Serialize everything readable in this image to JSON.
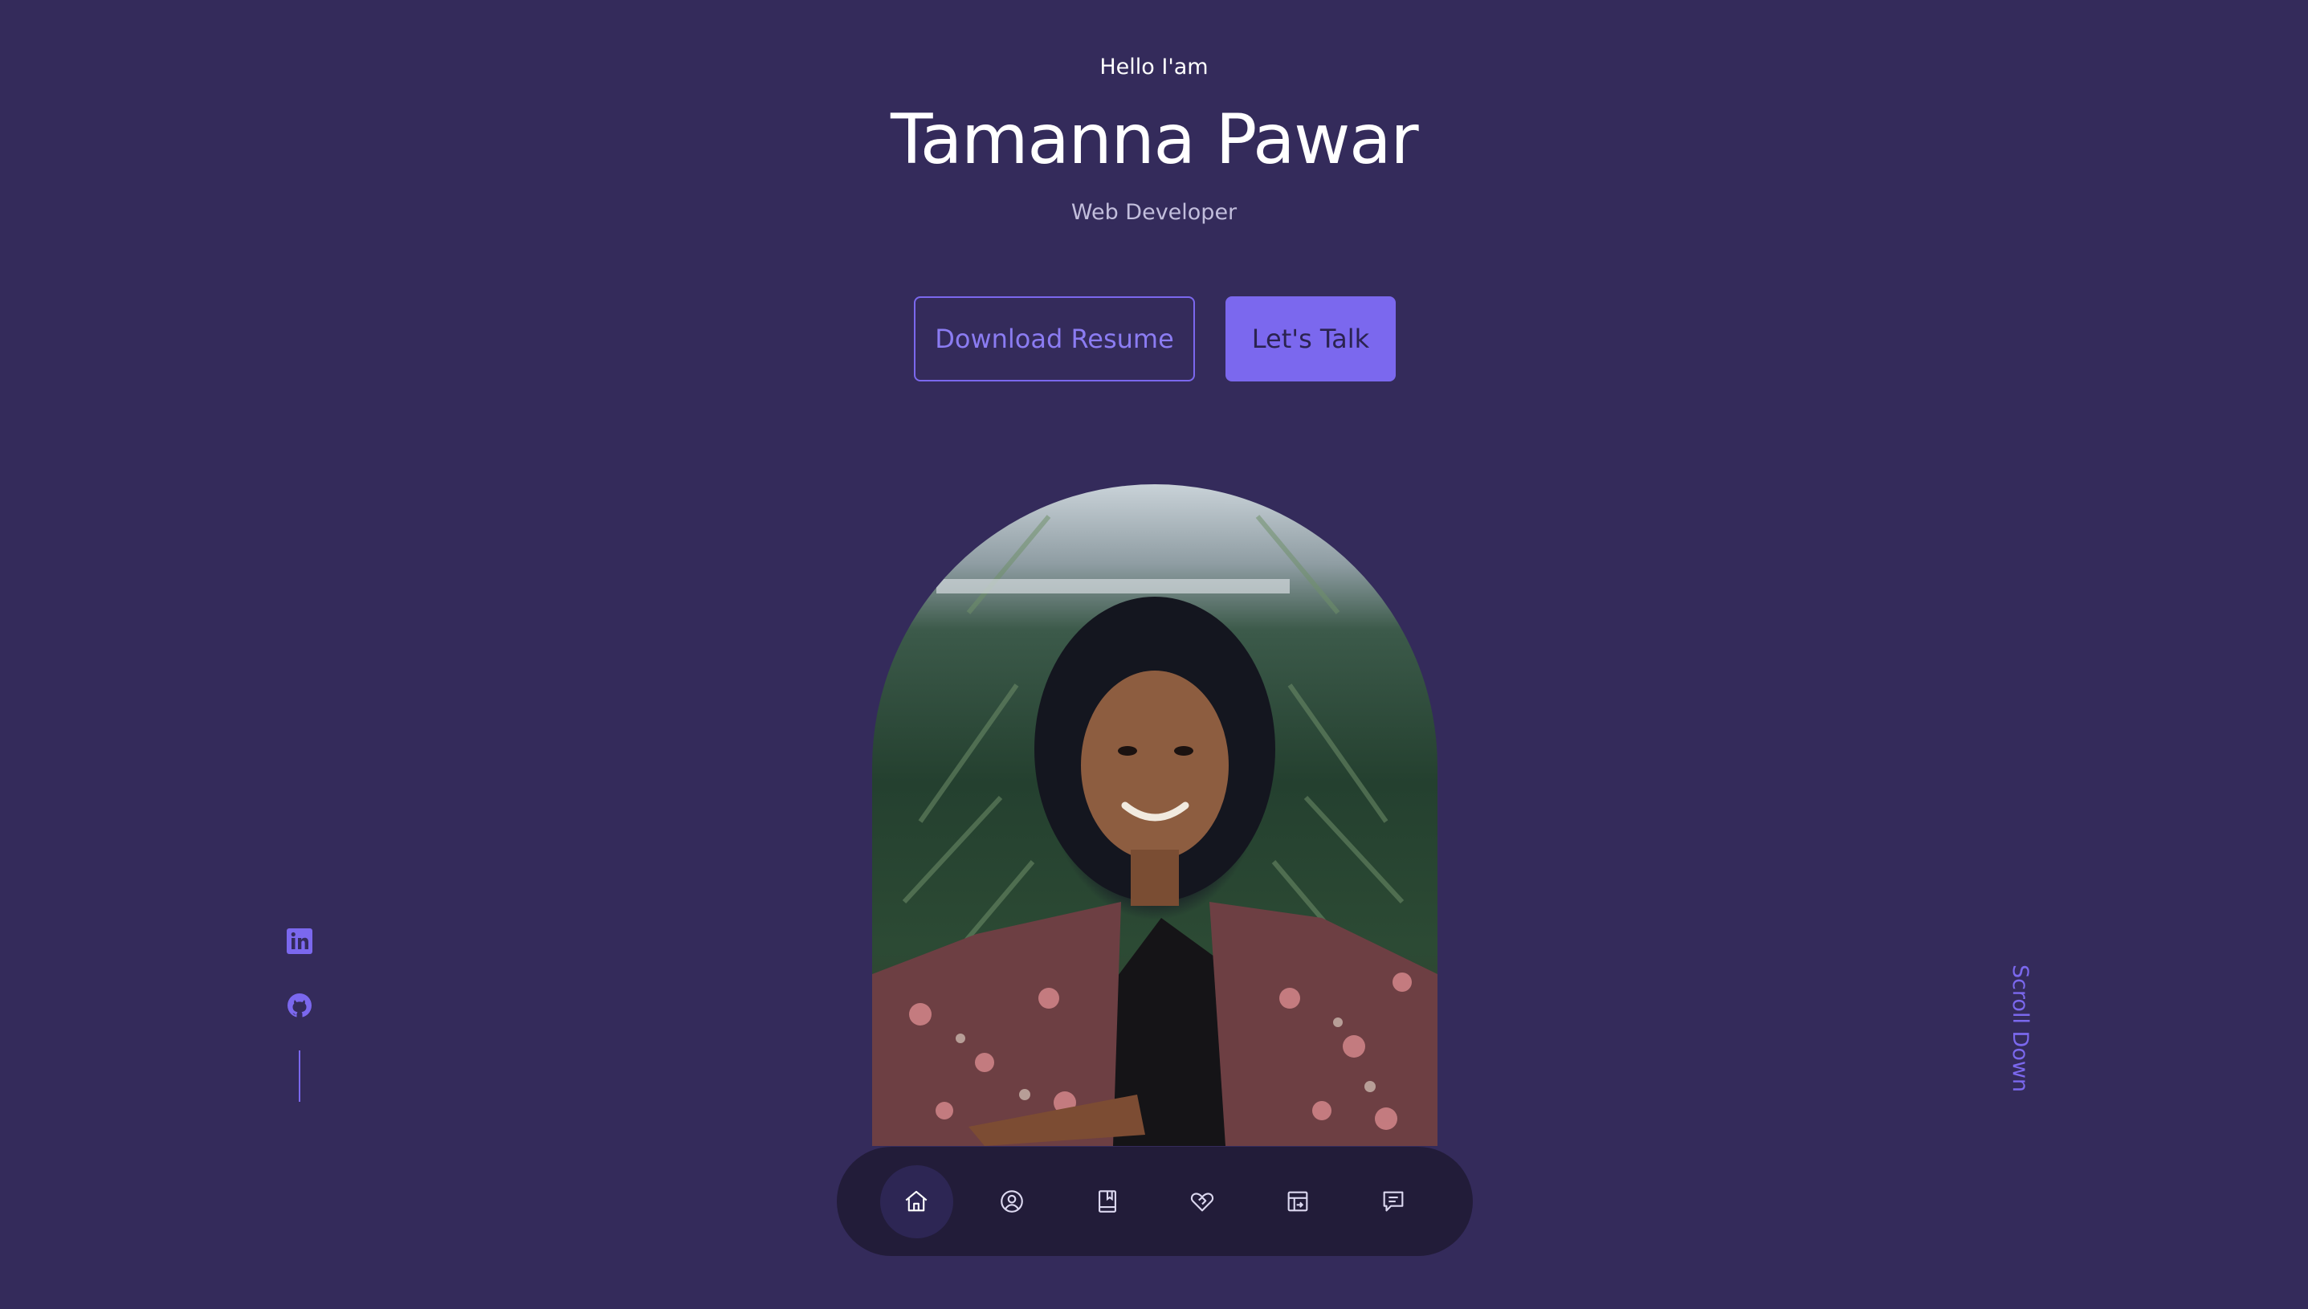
{
  "hero": {
    "greeting": "Hello I'am",
    "name": "Tamanna Pawar",
    "role": "Web Developer"
  },
  "buttons": {
    "download_label": "Download Resume",
    "talk_label": "Let's Talk"
  },
  "portrait": {
    "alt": "portrait photo"
  },
  "social": [
    {
      "icon": "linkedin-icon"
    },
    {
      "icon": "github-icon"
    }
  ],
  "scroll_label": "Scroll Down",
  "nav": [
    {
      "icon": "home-icon",
      "active": true
    },
    {
      "icon": "user-icon",
      "active": false
    },
    {
      "icon": "book-icon",
      "active": false
    },
    {
      "icon": "handshake-icon",
      "active": false
    },
    {
      "icon": "portfolio-icon",
      "active": false
    },
    {
      "icon": "message-icon",
      "active": false
    }
  ],
  "colors": {
    "background": "#342b5b",
    "accent": "#7b68ee",
    "text": "#ffffff",
    "muted": "#c2bedc"
  }
}
